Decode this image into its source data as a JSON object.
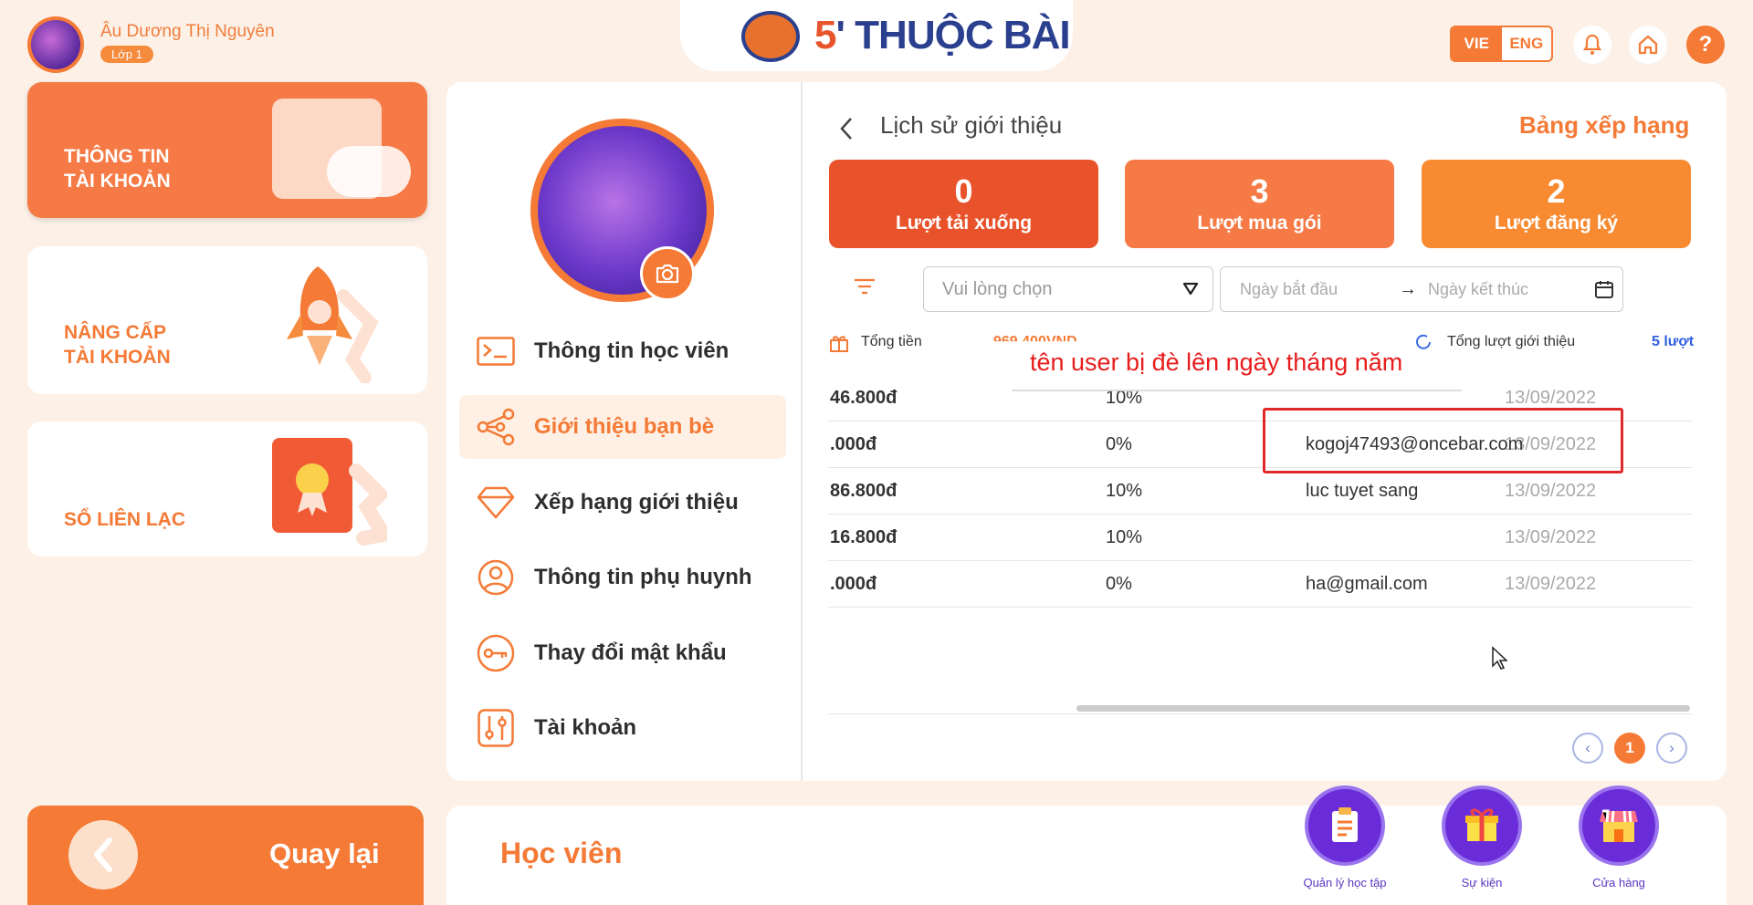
{
  "header": {
    "user_name": "Âu Dương Thị Nguyên",
    "user_grade": "Lớp 1",
    "logo": {
      "five": "5",
      "text": "THUỘC BÀI"
    },
    "lang": {
      "active": "VIE",
      "other": "ENG"
    },
    "icons": [
      "bell-icon",
      "home-icon",
      "help-icon"
    ],
    "help_glyph": "?"
  },
  "left_cards": [
    {
      "line1": "THÔNG TIN",
      "line2": "TÀI KHOẢN",
      "active": true
    },
    {
      "line1": "NÂNG CẤP",
      "line2": "TÀI KHOẢN",
      "active": false
    },
    {
      "line1": "",
      "line2": "SỔ LIÊN LẠC",
      "active": false
    }
  ],
  "profile_menu": [
    {
      "label": "Thông tin học viên",
      "icon": "terminal-icon"
    },
    {
      "label": "Giới thiệu bạn bè",
      "icon": "share-icon",
      "active": true
    },
    {
      "label": "Xếp hạng giới thiệu",
      "icon": "diamond-icon"
    },
    {
      "label": "Thông tin phụ huynh",
      "icon": "user-circle-icon"
    },
    {
      "label": "Thay đổi mật khẩu",
      "icon": "key-icon"
    },
    {
      "label": "Tài khoản",
      "icon": "sliders-icon"
    }
  ],
  "content": {
    "title": "Lịch sử giới thiệu",
    "ranking_link": "Bảng xếp hạng",
    "stats": [
      {
        "value": "0",
        "label": "Lượt tải xuống",
        "color": "#e8532b"
      },
      {
        "value": "3",
        "label": "Lượt mua gói",
        "color": "#f57a45"
      },
      {
        "value": "2",
        "label": "Lượt đăng ký",
        "color": "#f88b32"
      }
    ],
    "filter": {
      "select_placeholder": "Vui lòng chọn",
      "start_placeholder": "Ngày bắt đầu",
      "end_placeholder": "Ngày kết thúc"
    },
    "summary": {
      "total_money_label": "Tổng tiền",
      "total_money_value": "969.400VND",
      "total_ref_label": "Tổng lượt giới thiệu",
      "total_ref_value": "5 lượt"
    },
    "rows": [
      {
        "amount": "46.800đ",
        "percent": "10%",
        "user": "",
        "date": "13/09/2022"
      },
      {
        "amount": ".000đ",
        "percent": "0%",
        "user": "kogoj47493@oncebar.com",
        "date": "13/09/2022"
      },
      {
        "amount": "86.800đ",
        "percent": "10%",
        "user": "luc tuyet sang",
        "date": "13/09/2022"
      },
      {
        "amount": "16.800đ",
        "percent": "10%",
        "user": "",
        "date": "13/09/2022"
      },
      {
        "amount": ".000đ",
        "percent": "0%",
        "user": "ha@gmail.com",
        "date": "13/09/2022"
      }
    ],
    "annotation": "tên user bị đè lên ngày tháng năm",
    "pagination": {
      "current": "1"
    }
  },
  "bottom": {
    "back_label": "Quay lại",
    "section_label": "Học viên",
    "dock": [
      {
        "label": "Quản lý học tập",
        "icon": "clipboard-icon"
      },
      {
        "label": "Sự kiện",
        "icon": "gift-icon"
      },
      {
        "label": "Cửa hàng",
        "icon": "shop-icon"
      }
    ]
  },
  "colors": {
    "accent": "#f47a36",
    "background": "#fdf1e7",
    "annotation": "#e81c1c",
    "dock": "#6a2cd9"
  }
}
